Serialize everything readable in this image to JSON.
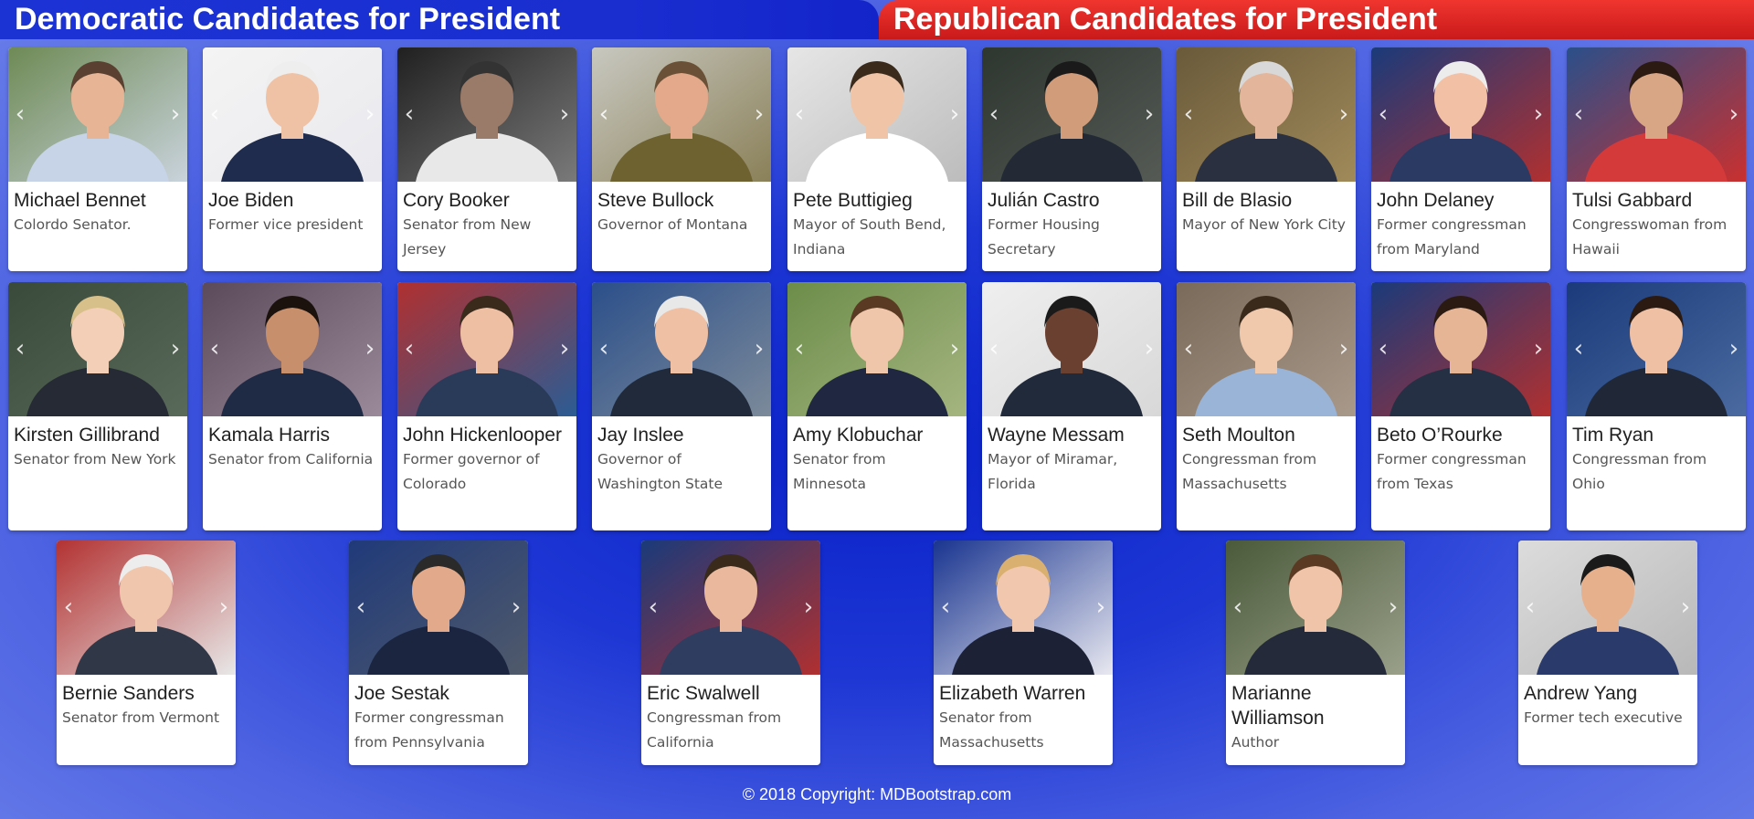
{
  "tabs": {
    "democratic": "Democratic Candidates for President",
    "republican": "Republican Candidates for President"
  },
  "colors": {
    "democratic_tab": "#1c33d4",
    "republican_tab": "#e02a26",
    "background": "#1d36d4",
    "card": "#ffffff"
  },
  "carousel": {
    "prev_icon": "chevron-left-icon",
    "next_icon": "chevron-right-icon",
    "prev_glyph": "‹",
    "next_glyph": "›"
  },
  "candidates": [
    {
      "name": "Michael Bennet",
      "desc": "Colordo Senator."
    },
    {
      "name": "Joe Biden",
      "desc": "Former vice president"
    },
    {
      "name": "Cory Booker",
      "desc": "Senator from New Jersey"
    },
    {
      "name": "Steve Bullock",
      "desc": "Governor of Montana"
    },
    {
      "name": "Pete Buttigieg",
      "desc": "Mayor of South Bend, Indiana"
    },
    {
      "name": "Julián Castro",
      "desc": "Former Housing Secretary"
    },
    {
      "name": "Bill de Blasio",
      "desc": "Mayor of New York City"
    },
    {
      "name": "John Delaney",
      "desc": "Former congressman from Maryland"
    },
    {
      "name": "Tulsi Gabbard",
      "desc": "Congresswoman from Hawaii"
    },
    {
      "name": "Kirsten Gillibrand",
      "desc": "Senator from New York"
    },
    {
      "name": "Kamala Harris",
      "desc": "Senator from California"
    },
    {
      "name": "John Hickenlooper",
      "desc": "Former governor of Colorado"
    },
    {
      "name": "Jay Inslee",
      "desc": "Governor of Washington State"
    },
    {
      "name": "Amy Klobuchar",
      "desc": "Senator from Minnesota"
    },
    {
      "name": "Wayne Messam",
      "desc": "Mayor of Miramar, Florida"
    },
    {
      "name": "Seth Moulton",
      "desc": "Congressman from Massachusetts"
    },
    {
      "name": "Beto O’Rourke",
      "desc": "Former congressman from Texas"
    },
    {
      "name": "Tim Ryan",
      "desc": "Congressman from Ohio"
    },
    {
      "name": "Bernie Sanders",
      "desc": "Senator from Vermont"
    },
    {
      "name": "Joe Sestak",
      "desc": "Former congressman from Pennsylvania"
    },
    {
      "name": "Eric Swalwell",
      "desc": "Congressman from California"
    },
    {
      "name": "Elizabeth Warren",
      "desc": "Senator from Massachusetts"
    },
    {
      "name": "Marianne Williamson",
      "desc": "Author"
    },
    {
      "name": "Andrew Yang",
      "desc": "Former tech executive"
    }
  ],
  "footer": {
    "copyright": "© 2018 Copyright:",
    "link": "MDBootstrap.com"
  }
}
